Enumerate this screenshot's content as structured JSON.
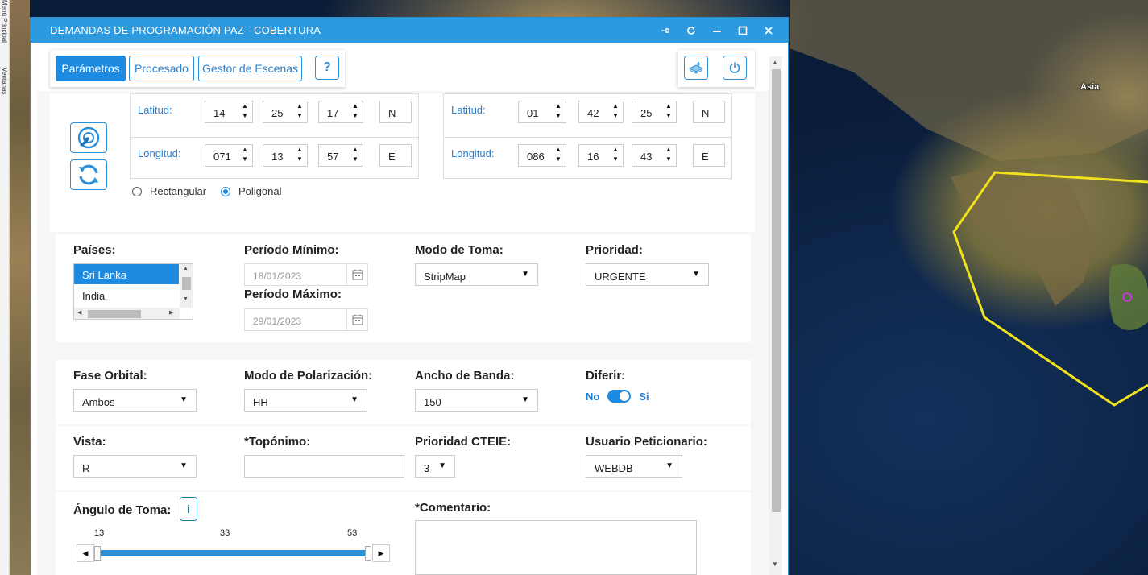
{
  "left_strip": {
    "item1": "Menú Principal",
    "item2": "Ventanas"
  },
  "map": {
    "region_label": "Asia",
    "polygon_color": "#f0e21c",
    "marker_color": "#c03ad8"
  },
  "window": {
    "title": "DEMANDAS DE PROGRAMACIÓN PAZ - COBERTURA",
    "controls": [
      "pin-icon",
      "refresh-icon",
      "minimize-icon",
      "maximize-icon",
      "close-icon"
    ]
  },
  "tabs": [
    {
      "label": "Parámetros",
      "active": true
    },
    {
      "label": "Procesado",
      "active": false
    },
    {
      "label": "Gestor de Escenas",
      "active": false
    }
  ],
  "help_button": "?",
  "coords": {
    "lat_label": "Latitud:",
    "lon_label": "Longitud:",
    "point1": {
      "lat": {
        "deg": "14",
        "min": "25",
        "sec": "17",
        "hemi": "N"
      },
      "lon": {
        "deg": "071",
        "min": "13",
        "sec": "57",
        "hemi": "E"
      }
    },
    "point2": {
      "lat": {
        "deg": "01",
        "min": "42",
        "sec": "25",
        "hemi": "N"
      },
      "lon": {
        "deg": "086",
        "min": "16",
        "sec": "43",
        "hemi": "E"
      }
    }
  },
  "shape": {
    "rect_label": "Rectangular",
    "poly_label": "Poligonal",
    "selected": "Poligonal"
  },
  "paises": {
    "label": "Países:",
    "items": [
      "Sri Lanka",
      "India"
    ],
    "selected": "Sri Lanka"
  },
  "periodo_min": {
    "label": "Período Mínimo:",
    "value": "18/01/2023"
  },
  "periodo_max": {
    "label": "Período Máximo:",
    "value": "29/01/2023"
  },
  "modo_toma": {
    "label": "Modo de Toma:",
    "value": "StripMap"
  },
  "prioridad": {
    "label": "Prioridad:",
    "value": "URGENTE"
  },
  "fase_orbital": {
    "label": "Fase Orbital:",
    "value": "Ambos"
  },
  "polarizacion": {
    "label": "Modo de Polarización:",
    "value": "HH"
  },
  "ancho_banda": {
    "label": "Ancho de Banda:",
    "value": "150"
  },
  "diferir": {
    "label": "Diferir:",
    "off_label": "No",
    "on_label": "Si",
    "state": "Si"
  },
  "vista": {
    "label": "Vista:",
    "value": "R"
  },
  "toponimo": {
    "label": "*Topónimo:",
    "value": ""
  },
  "prioridad_cteie": {
    "label": "Prioridad CTEIE:",
    "value": "3"
  },
  "usuario": {
    "label": "Usuario Peticionario:",
    "value": "WEBDB"
  },
  "angulo": {
    "label": "Ángulo de Toma:",
    "info": "i",
    "min_tick": "13",
    "mid_tick": "33",
    "max_tick": "53",
    "range": [
      13,
      53
    ]
  },
  "comentario": {
    "label": "*Comentario:",
    "value": ""
  }
}
